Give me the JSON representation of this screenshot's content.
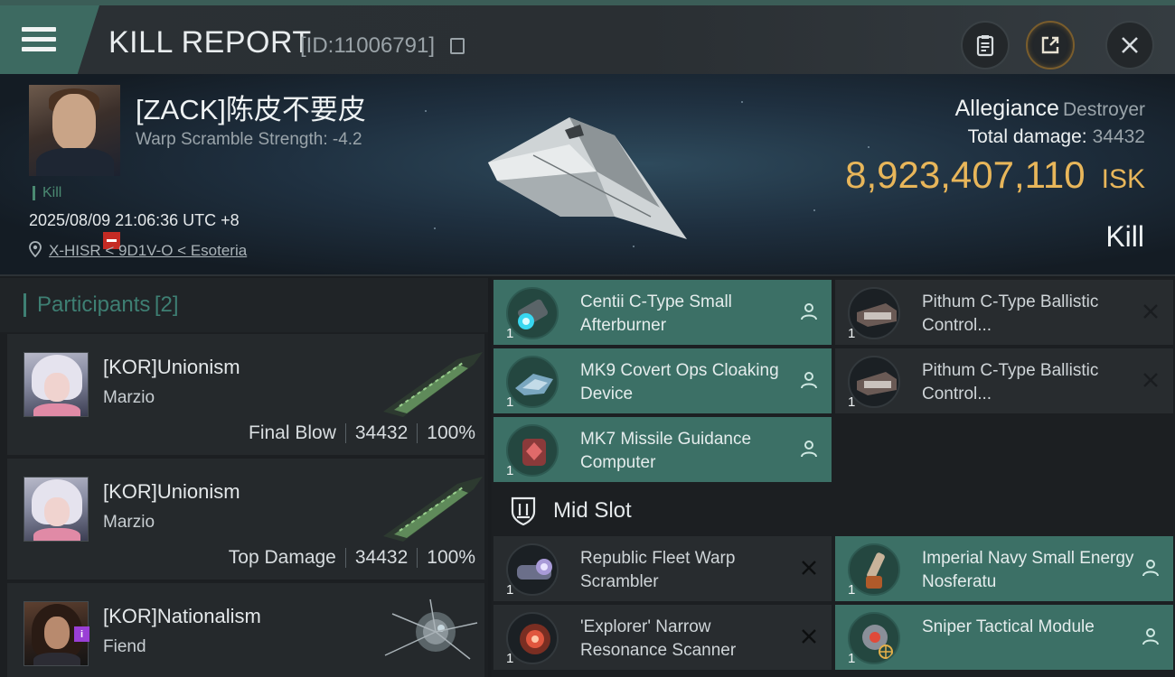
{
  "header": {
    "title": "KILL REPORT",
    "report_id": "[ID:11006791]"
  },
  "victim": {
    "name": "[ZACK]陈皮不要皮",
    "warp_scramble": "Warp Scramble Strength: -4.2",
    "tag": "Kill",
    "time": "2025/08/09 21:06:36 UTC +8",
    "location": "X-HISR < 9D1V-O < Esoteria",
    "ship_name": "Allegiance",
    "ship_class": "Destroyer",
    "total_damage_label": "Total damage:",
    "total_damage": "34432",
    "isk_value": "8,923,407,110",
    "isk_unit": "ISK",
    "result": "Kill"
  },
  "participants": {
    "title": "Participants",
    "count": "[2]",
    "items": [
      {
        "name": "[KOR]Unionism",
        "ship": "Marzio",
        "role": "Final Blow",
        "damage": "34432",
        "percent": "100%"
      },
      {
        "name": "[KOR]Unionism",
        "ship": "Marzio",
        "role": "Top Damage",
        "damage": "34432",
        "percent": "100%"
      },
      {
        "name": "[KOR]Nationalism",
        "ship": "Fiend"
      }
    ]
  },
  "modules": {
    "left_col": [
      {
        "name": "Centii C-Type Small Afterburner",
        "qty": "1",
        "style": "teal",
        "status": "person"
      },
      {
        "name": "MK9 Covert Ops Cloaking Device",
        "qty": "1",
        "style": "teal",
        "status": "person"
      },
      {
        "name": "MK7 Missile Guidance Computer",
        "qty": "1",
        "style": "teal",
        "status": "person"
      }
    ],
    "right_col": [
      {
        "name": "Pithum C-Type Ballistic Control...",
        "qty": "1",
        "style": "dark",
        "status": "x"
      },
      {
        "name": "Pithum C-Type Ballistic Control...",
        "qty": "1",
        "style": "dark",
        "status": "x"
      }
    ],
    "mid_slot_label": "Mid Slot",
    "mid_left": [
      {
        "name": "Republic Fleet Warp Scrambler",
        "qty": "1",
        "style": "dark",
        "status": "x"
      },
      {
        "name": "'Explorer' Narrow Resonance Scanner",
        "qty": "1",
        "style": "dark",
        "status": "x"
      }
    ],
    "mid_right": [
      {
        "name": "Imperial Navy Small Energy Nosferatu",
        "qty": "1",
        "style": "teal",
        "status": "person"
      },
      {
        "name": "Sniper Tactical Module",
        "qty": "1",
        "style": "teal",
        "status": "person"
      }
    ]
  },
  "colors": {
    "accent_teal": "#3c7066",
    "isk_gold": "#e8b65a",
    "badge_red": "#c52b24",
    "badge_purple": "#9a3fd6"
  }
}
